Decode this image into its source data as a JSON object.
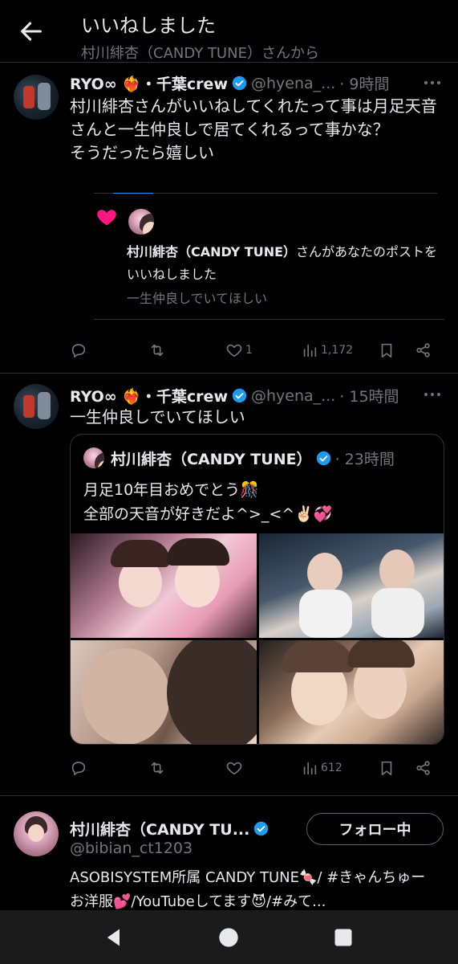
{
  "header": {
    "title": "いいねしました",
    "subtitle": "村川緋杏（CANDY TUNE）さんから"
  },
  "tweet1": {
    "name": "RYO∞ ❤️‍🔥・千葉crew",
    "handle": "@hyena_...",
    "time": "· 9時間",
    "text": "村川緋杏さんがいいねしてくれたって事は月足天音さんと一生仲良しで居てくれるって事かな？\nそうだったら嬉しい",
    "notification": {
      "actor": "村川緋杏（CANDY TUNE）",
      "message": "さんがあなたのポストをいいねしました",
      "quoted": "一生仲良しでいてほしい"
    },
    "likes": "1",
    "views": "1,172"
  },
  "tweet2": {
    "name": "RYO∞ ❤️‍🔥・千葉crew",
    "handle": "@hyena_...",
    "time": "· 15時間",
    "text": "一生仲良しでいてほしい",
    "quote": {
      "name": "村川緋杏（CANDY TUNE）",
      "time": "· 23時間",
      "text": "月足10年目おめでとう🎊\n全部の天音が好きだよ^>_<^✌🏻💞"
    },
    "views": "612"
  },
  "follow_card": {
    "name": "村川緋杏（CANDY TU...",
    "handle": "@bibian_ct1203",
    "button": "フォロー中",
    "bio": "ASOBISYSTEM所属 CANDY TUNE🍬/ #きゃんちゅー お洋服💕/YouTubeしてます😈/#みて..."
  },
  "colors": {
    "background": "#000000",
    "text": "#e7e9ea",
    "secondary": "#71767b",
    "verified": "#1d9bf0",
    "heart": "#f91880",
    "border": "#2f3336"
  },
  "icons": [
    "back-arrow-icon",
    "verified-badge-icon",
    "more-icon",
    "heart-icon",
    "reply-icon",
    "retweet-icon",
    "like-icon",
    "views-icon",
    "bookmark-icon",
    "share-icon",
    "nav-back-icon",
    "nav-home-icon",
    "nav-recents-icon"
  ]
}
